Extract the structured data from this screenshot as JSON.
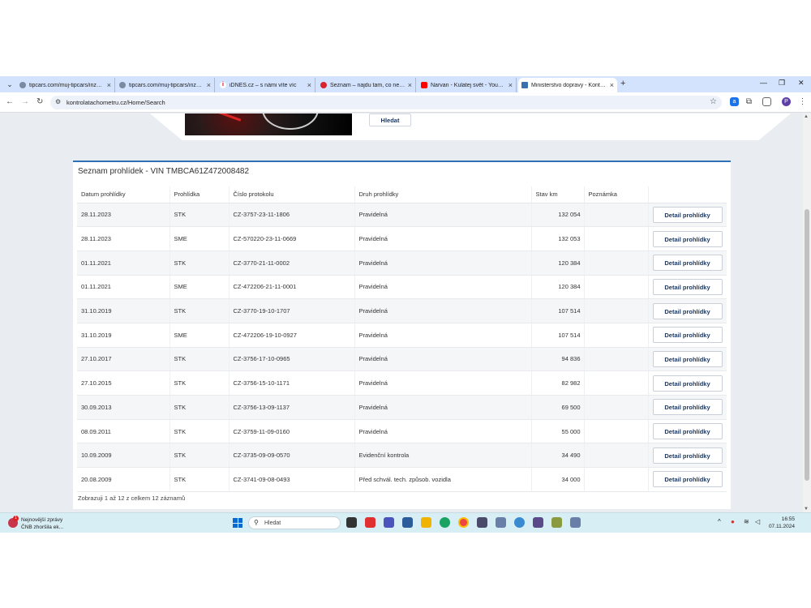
{
  "browser": {
    "tabs": [
      {
        "title": "tipcars.com/muj-tipcars/inzerce",
        "active": false
      },
      {
        "title": "tipcars.com/muj-tipcars/inzerce",
        "active": false
      },
      {
        "title": "iDNES.cz – s námi víte víc",
        "active": false
      },
      {
        "title": "Seznam – najdu tam, co neznám",
        "active": false
      },
      {
        "title": "Narvan - Kulatej svět - YouTube",
        "active": false
      },
      {
        "title": "Ministerstvo dopravy - Kontrola",
        "active": true
      }
    ],
    "url": "kontrolatachometru.cz/Home/Search",
    "profile_initial": "P"
  },
  "page": {
    "search_button": "Hledat",
    "card_title": "Seznam prohlídek - VIN TMBCA61Z472008482",
    "columns": [
      "Datum prohlídky",
      "Prohlídka",
      "Číslo protokolu",
      "Druh prohlídky",
      "Stav km",
      "Poznámka",
      ""
    ],
    "detail_label": "Detail prohlídky",
    "rows": [
      {
        "date": "28.11.2023",
        "type": "STK",
        "protocol": "CZ-3757-23-11-1806",
        "kind": "Pravidelná",
        "km": "132 054",
        "note": ""
      },
      {
        "date": "28.11.2023",
        "type": "SME",
        "protocol": "CZ-570220-23-11-0669",
        "kind": "Pravidelná",
        "km": "132 053",
        "note": ""
      },
      {
        "date": "01.11.2021",
        "type": "STK",
        "protocol": "CZ-3770-21-11-0002",
        "kind": "Pravidelná",
        "km": "120 384",
        "note": ""
      },
      {
        "date": "01.11.2021",
        "type": "SME",
        "protocol": "CZ-472206-21-11-0001",
        "kind": "Pravidelná",
        "km": "120 384",
        "note": ""
      },
      {
        "date": "31.10.2019",
        "type": "STK",
        "protocol": "CZ-3770-19-10-1707",
        "kind": "Pravidelná",
        "km": "107 514",
        "note": ""
      },
      {
        "date": "31.10.2019",
        "type": "SME",
        "protocol": "CZ-472206-19-10-0927",
        "kind": "Pravidelná",
        "km": "107 514",
        "note": ""
      },
      {
        "date": "27.10.2017",
        "type": "STK",
        "protocol": "CZ-3756-17-10-0965",
        "kind": "Pravidelná",
        "km": "94 836",
        "note": ""
      },
      {
        "date": "27.10.2015",
        "type": "STK",
        "protocol": "CZ-3756-15-10-1171",
        "kind": "Pravidelná",
        "km": "82 982",
        "note": ""
      },
      {
        "date": "30.09.2013",
        "type": "STK",
        "protocol": "CZ-3756-13-09-1137",
        "kind": "Pravidelná",
        "km": "69 500",
        "note": ""
      },
      {
        "date": "08.09.2011",
        "type": "STK",
        "protocol": "CZ-3759-11-09-0160",
        "kind": "Pravidelná",
        "km": "55 000",
        "note": ""
      },
      {
        "date": "10.09.2009",
        "type": "STK",
        "protocol": "CZ-3735-09-09-0570",
        "kind": "Evidenční kontrola",
        "km": "34 490",
        "note": ""
      },
      {
        "date": "20.08.2009",
        "type": "STK",
        "protocol": "CZ-3741-09-08-0493",
        "kind": "Před schvál. tech. způsob. vozidla",
        "km": "34 000",
        "note": ""
      }
    ],
    "footer_info": "Zobrazuji 1 až 12 z celkem 12 záznamů"
  },
  "taskbar": {
    "news_title": "Nejnovější zprávy",
    "news_sub": "ČNB zhoršila ek...",
    "news_badge": "1",
    "search_placeholder": "Hledat",
    "time": "16:55",
    "date": "07.11.2024"
  },
  "colors": {
    "accent": "#2f6fb3",
    "tabstrip": "#d3e3fd",
    "taskbar": "#d8eef5"
  }
}
